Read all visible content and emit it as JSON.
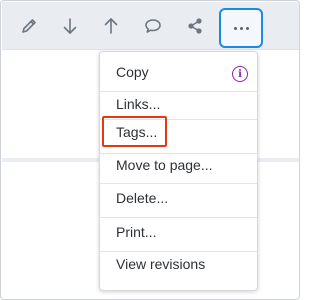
{
  "toolbar": {
    "buttons": [
      {
        "name": "edit",
        "icon": "pencil-icon"
      },
      {
        "name": "download",
        "icon": "arrow-down-icon"
      },
      {
        "name": "upload",
        "icon": "arrow-up-icon"
      },
      {
        "name": "comment",
        "icon": "speech-bubble-icon"
      },
      {
        "name": "share",
        "icon": "share-icon"
      },
      {
        "name": "more",
        "icon": "ellipsis-icon"
      }
    ]
  },
  "menu": {
    "items": [
      {
        "label": "Copy",
        "icon": "info-icon",
        "icon_glyph": "i"
      },
      {
        "label": "Links..."
      },
      {
        "label": "Tags..."
      },
      {
        "label": "Move to page..."
      },
      {
        "label": "Delete..."
      },
      {
        "label": "Print..."
      },
      {
        "label": "View revisions"
      }
    ]
  },
  "colors": {
    "highlight_border": "#e53912",
    "active_button_border": "#1e88e5",
    "info_icon": "#8e24aa",
    "toolbar_bg": "#e9edf1"
  }
}
